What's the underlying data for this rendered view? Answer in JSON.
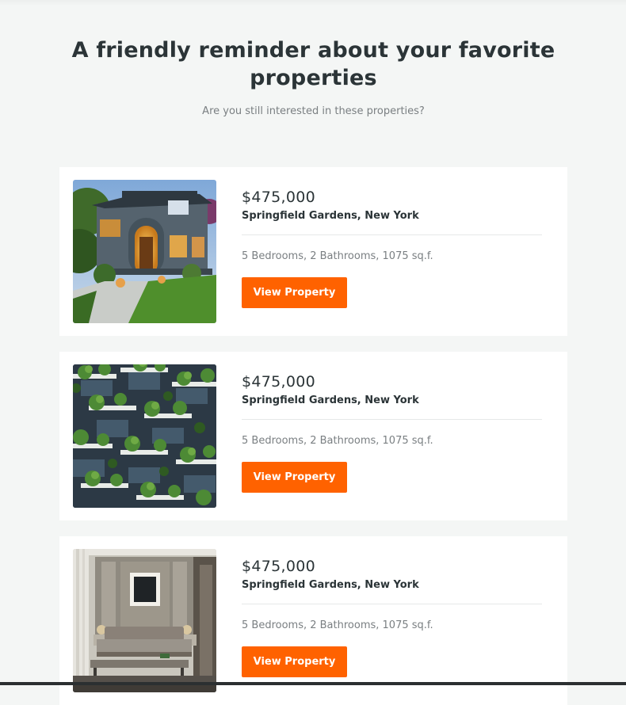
{
  "header": {
    "title": "A friendly reminder about your favorite properties",
    "subtitle": "Are you still interested in these properties?"
  },
  "properties": [
    {
      "image": "craftsman-house-photo",
      "price": "$475,000",
      "location": "Springfield Gardens, New York",
      "details": "5 Bedrooms, 2 Bathrooms, 1075 sq.f.",
      "button_label": "View Property"
    },
    {
      "image": "green-balcony-building-photo",
      "price": "$475,000",
      "location": "Springfield Gardens, New York",
      "details": "5 Bedrooms, 2 Bathrooms, 1075 sq.f.",
      "button_label": "View Property"
    },
    {
      "image": "modern-bedroom-photo",
      "price": "$475,000",
      "location": "Springfield Gardens, New York",
      "details": "5 Bedrooms, 2 Bathrooms, 1075 sq.f.",
      "button_label": "View Property"
    }
  ],
  "colors": {
    "background": "#f4f6f5",
    "card": "#ffffff",
    "accent": "#ff6200",
    "text": "#2b3437",
    "muted": "#7a7f82"
  }
}
